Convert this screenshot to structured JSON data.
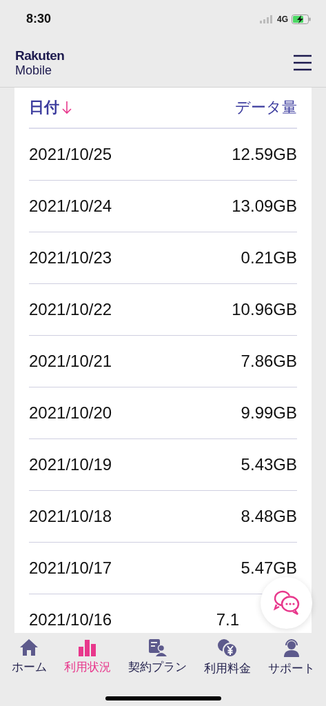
{
  "status_bar": {
    "time": "8:30",
    "network": "4G"
  },
  "header": {
    "logo_top": "Rakuten",
    "logo_bottom": "Mobile"
  },
  "table": {
    "columns": [
      {
        "label": "日付",
        "sorted": true
      },
      {
        "label": "データ量"
      }
    ],
    "rows": [
      {
        "date": "2021/10/25",
        "amount": "12.59GB"
      },
      {
        "date": "2021/10/24",
        "amount": "13.09GB"
      },
      {
        "date": "2021/10/23",
        "amount": "0.21GB"
      },
      {
        "date": "2021/10/22",
        "amount": "10.96GB"
      },
      {
        "date": "2021/10/21",
        "amount": "7.86GB"
      },
      {
        "date": "2021/10/20",
        "amount": "9.99GB"
      },
      {
        "date": "2021/10/19",
        "amount": "5.43GB"
      },
      {
        "date": "2021/10/18",
        "amount": "8.48GB"
      },
      {
        "date": "2021/10/17",
        "amount": "5.47GB"
      },
      {
        "date": "2021/10/16",
        "amount": "7.1",
        "covered": true
      }
    ]
  },
  "bottom_nav": [
    {
      "kind": "home",
      "label": "ホーム",
      "selected": false
    },
    {
      "kind": "usage",
      "label": "利用状況",
      "selected": true
    },
    {
      "kind": "plan",
      "label": "契約プラン",
      "selected": false
    },
    {
      "kind": "fee",
      "label": "利用料金",
      "selected": false
    },
    {
      "kind": "support",
      "label": "サポート",
      "selected": false
    }
  ]
}
